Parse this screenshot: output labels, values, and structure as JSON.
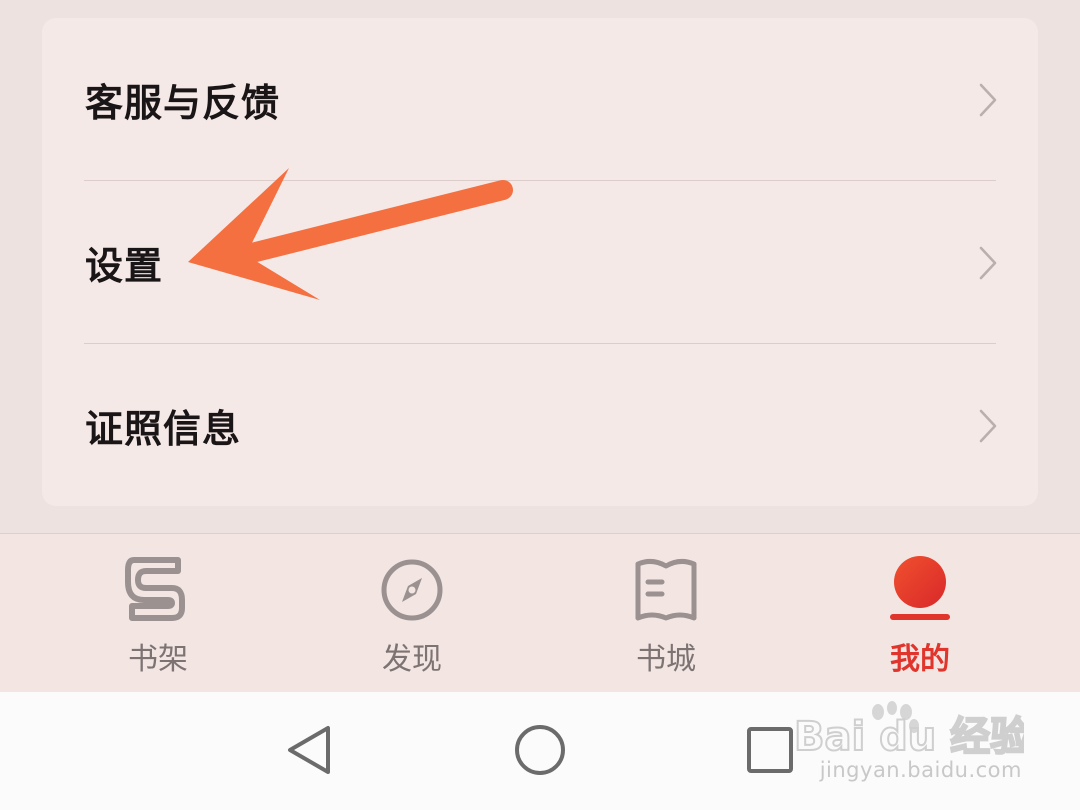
{
  "menu": {
    "items": [
      {
        "label": "客服与反馈"
      },
      {
        "label": "设置"
      },
      {
        "label": "证照信息"
      }
    ]
  },
  "tabbar": {
    "tabs": [
      {
        "label": "书架",
        "icon": "bookshelf-icon"
      },
      {
        "label": "发现",
        "icon": "compass-icon"
      },
      {
        "label": "书城",
        "icon": "book-open-icon"
      },
      {
        "label": "我的",
        "icon": "profile-icon"
      }
    ],
    "active_index": 3
  },
  "system_nav": {
    "back": "back-triangle-icon",
    "home": "home-circle-icon",
    "recents": "recents-square-icon"
  },
  "watermark": {
    "brand": "Bai du 经验",
    "url": "jingyan.baidu.com"
  },
  "colors": {
    "accent": "#e0352c",
    "annotation_arrow": "#f47040"
  }
}
